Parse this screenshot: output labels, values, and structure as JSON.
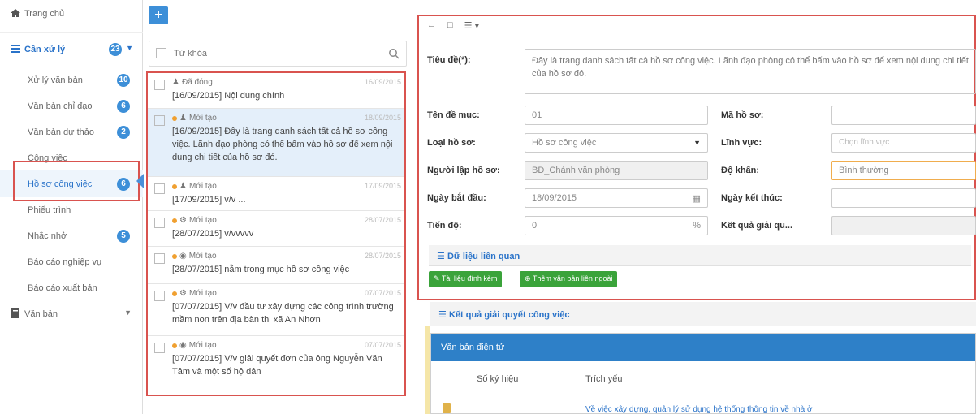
{
  "sidebar": {
    "home": "Trang chủ",
    "pending": {
      "label": "Cần xử lý",
      "count": "23"
    },
    "items": [
      {
        "label": "Xử lý văn bản",
        "count": "10"
      },
      {
        "label": "Văn bản chỉ đạo",
        "count": "6"
      },
      {
        "label": "Văn bản dự thảo",
        "count": "2"
      },
      {
        "label": "Công việc",
        "count": ""
      },
      {
        "label": "Hồ sơ công việc",
        "count": "6"
      },
      {
        "label": "Phiếu trình",
        "count": ""
      },
      {
        "label": "Nhắc nhở",
        "count": "5"
      },
      {
        "label": "Báo cáo nghiệp vụ",
        "count": ""
      },
      {
        "label": "Báo cáo xuất bản",
        "count": ""
      }
    ],
    "documents": "Văn bản"
  },
  "list": {
    "add_label": "+",
    "search_placeholder": "Từ khóa",
    "items": [
      {
        "status": "Đã đóng",
        "date": "16/09/2015",
        "title": "[16/09/2015] Nội dung chính"
      },
      {
        "status": "Mới tạo",
        "date": "18/09/2015",
        "title": "[16/09/2015] Đây là trang danh sách tất cả hồ sơ công việc. Lãnh đạo phòng có thể bấm vào hồ sơ để xem nội dung chi tiết của hồ sơ đó."
      },
      {
        "status": "Mới tạo",
        "date": "17/09/2015",
        "title": "[17/09/2015] v/v ..."
      },
      {
        "status": "Mới tạo",
        "date": "28/07/2015",
        "title": "[28/07/2015] v/vvvvv"
      },
      {
        "status": "Mới tạo",
        "date": "28/07/2015",
        "title": "[28/07/2015] nằm trong mục hồ sơ công việc"
      },
      {
        "status": "Mới tạo",
        "date": "07/07/2015",
        "title": "[07/07/2015] V/v đầu tư xây dựng các công trình trường mầm non trên địa bàn thị xã An Nhơn"
      },
      {
        "status": "Mới tạo",
        "date": "07/07/2015",
        "title": "[07/07/2015] V/v giải quyết đơn của ông Nguyễn Văn Tâm và một số hộ dân"
      }
    ]
  },
  "form": {
    "title_label": "Tiêu đề(*):",
    "title_value": "Đây là trang danh sách tất cả hồ sơ công việc. Lãnh đạo phòng có thể bấm vào hồ sơ để xem nội dung chi tiết của hồ sơ đó.",
    "heading_label": "Tên đề mục:",
    "heading_value": "01",
    "code_label": "Mã hồ sơ:",
    "code_value": "",
    "type_label": "Loại hồ sơ:",
    "type_value": "Hồ sơ công việc",
    "field_label": "Lĩnh vực:",
    "field_placeholder": "Chọn lĩnh vực",
    "creator_label": "Người lập hồ sơ:",
    "creator_value": "BD_Chánh văn phòng",
    "urgency_label": "Độ khẩn:",
    "urgency_value": "Bình thường",
    "start_label": "Ngày bắt đầu:",
    "start_value": "18/09/2015",
    "end_label": "Ngày kết thúc:",
    "end_value": "",
    "progress_label": "Tiến độ:",
    "progress_value": "0",
    "progress_unit": "%",
    "result_label": "Kết quả giải qu...",
    "result_value": "",
    "related_header": "Dữ liệu liên quan",
    "attach_button": "Tài liệu đính kèm",
    "add_external_button": "Thêm văn bản liên ngoài"
  },
  "result": {
    "header": "Kết quả giải quyết công việc",
    "panel_title": "Văn bản điện tử",
    "columns": [
      "Số ký hiệu",
      "Trích yếu"
    ],
    "rows": [
      {
        "number": "",
        "summary": "Về việc xây dựng, quản lý sử dụng hệ thống thông tin về nhà ở"
      }
    ]
  }
}
